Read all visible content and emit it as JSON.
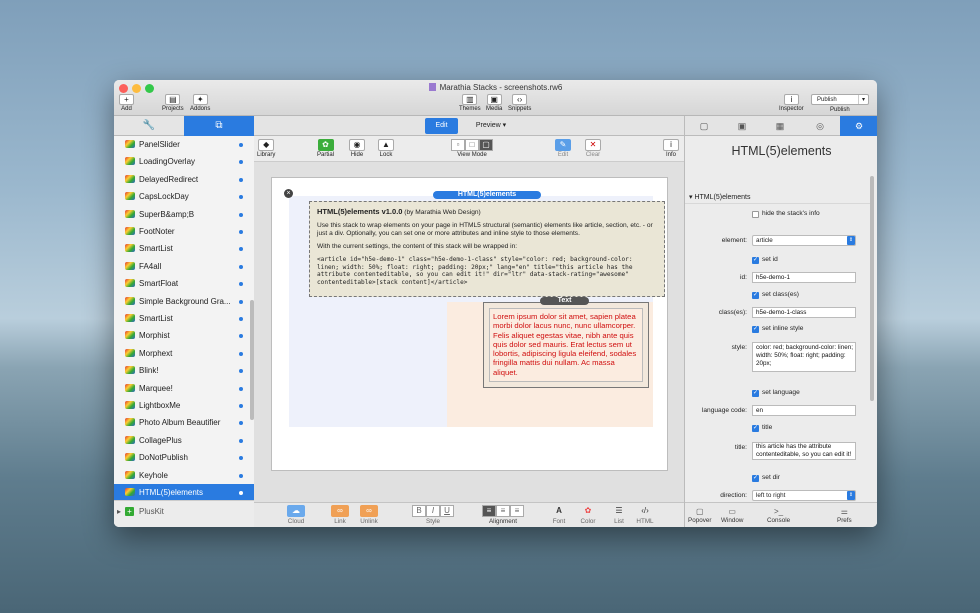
{
  "window": {
    "title": "Marathia Stacks - screenshots.rw6"
  },
  "toolbar": {
    "add": "Add",
    "projects": "Projects",
    "addons": "Addons",
    "themes": "Themes",
    "media": "Media",
    "snippets": "Snippets",
    "inspector": "Inspector",
    "publish_button": "Publish",
    "publish_label": "Publish"
  },
  "sidebar": {
    "items": [
      "PanelSlider",
      "LoadingOverlay",
      "DelayedRedirect",
      "CapsLockDay",
      "SuperB&amp;B",
      "FootNoter",
      "SmartList",
      "FA4all",
      "SmartFloat",
      "Simple Background Gra...",
      "SmartList",
      "Morphist",
      "Morphext",
      "Blink!",
      "Marquee!",
      "LightboxMe",
      "Photo Album Beautifier",
      "CollagePlus",
      "DoNotPublish",
      "Keyhole",
      "HTML(5)elements"
    ],
    "selected_index": 20,
    "pluskit": "PlusKit"
  },
  "center": {
    "mode_edit": "Edit",
    "mode_preview": "Preview",
    "tools": {
      "library": "Library",
      "partial": "Partial",
      "hide": "Hide",
      "lock": "Lock",
      "view_mode": "View Mode",
      "edit": "Edit",
      "clear": "Clear",
      "info": "Info"
    },
    "stack_pill": "HTML(5)elements",
    "info_title": "HTML(5)elements v1.0.0",
    "info_by": " (by Marathia Web Design)",
    "info_p1": "Use this stack to wrap elements on your page in HTML5 structural (semantic) elements like article, section, etc. - or just a div. Optionally, you can set one or more attributes and inline style to those elements.",
    "info_p2": "With the current settings, the content of this stack will be wrapped in:",
    "info_code": "<article id=\"h5e-demo-1\" class=\"h5e-demo-1-class\" style=\"color: red; background-color: linen; width: 50%; float: right; padding: 20px;\" lang=\"en\" title=\"this article has the attribute contenteditable, so you can edit it!\" dir=\"ltr\" data-stack-rating=\"awesome\" contenteditable>[stack content]</article>",
    "text_pill": "Text",
    "text_content": "Lorem ipsum dolor sit amet, sapien platea morbi dolor lacus nunc, nunc ullamcorper. Felis aliquet egestas vitae, nibh ante quis quis dolor sed mauris. Erat lectus sem ut lobortis, adipiscing ligula eleifend, sodales fringilla mattis dui nullam. Ac massa aliquet.",
    "footer": {
      "cloud": "Cloud",
      "link": "Link",
      "unlink": "Unlink",
      "style": "Style",
      "bold": "B",
      "italic": "I",
      "underline": "U",
      "alignment": "Alignment",
      "font": "Font",
      "color": "Color",
      "list": "List",
      "html": "HTML"
    }
  },
  "inspector": {
    "title": "HTML(5)elements",
    "section": "HTML(5)elements",
    "hide_info": "hide the stack's info",
    "element_label": "element:",
    "element_value": "article",
    "set_id": "set id",
    "id_label": "id:",
    "id_value": "h5e-demo-1",
    "set_class": "set class(es)",
    "class_label": "class(es):",
    "class_value": "h5e-demo-1-class",
    "set_style": "set inline style",
    "style_label": "style:",
    "style_value": "color: red; background-color: linen; width: 50%; float: right; padding: 20px;",
    "set_lang": "set language",
    "lang_label": "language code:",
    "lang_value": "en",
    "set_title": "title",
    "title_label": "title:",
    "title_value": "this article has the attribute contenteditable, so you can edit it!",
    "set_dir": "set dir",
    "dir_label": "direction:",
    "dir_value": "left to right",
    "footer": {
      "popover": "Popover",
      "window": "Window",
      "console": "Console",
      "prefs": "Prefs"
    }
  },
  "colors": {
    "accent": "#2a7be0",
    "text_red": "#d01010"
  }
}
